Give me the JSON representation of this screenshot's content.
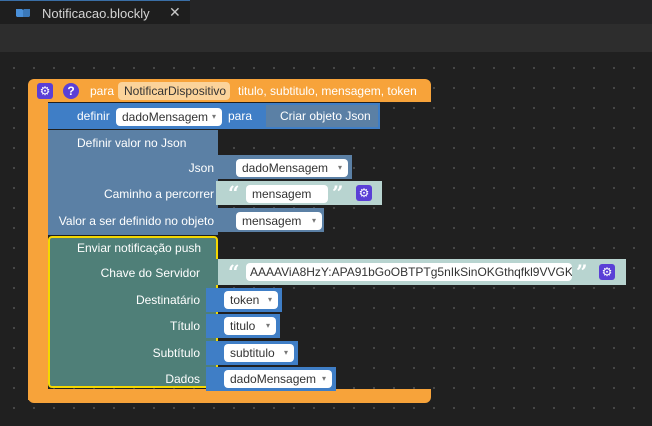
{
  "tab": {
    "title": "Notificacao.blockly",
    "close": "✕"
  },
  "procedure": {
    "para": "para",
    "name": "NotificarDispositivo",
    "params": "titulo, subtitulo, mensagem, token",
    "help": "?"
  },
  "definir": {
    "label": "definir",
    "variable": "dadoMensagem",
    "para": "para",
    "value": "Criar objeto Json"
  },
  "json_block": {
    "title": "Definir valor no Json",
    "json_label": "Json",
    "json_var": "dadoMensagem",
    "path_label": "Caminho a percorrer",
    "path_value": "mensagem",
    "value_label": "Valor a ser definido no objeto",
    "value_var": "mensagem"
  },
  "push_block": {
    "title": "Enviar notificação push",
    "server_key_label": "Chave do Servidor",
    "server_key_value": "AAAAViA8HzY:APA91bGoOBTPTg5nIkSinOKGthqfkl9VVGKI...",
    "dest_label": "Destinatário",
    "dest_var": "token",
    "title_label": "Título",
    "title_var": "titulo",
    "subtitle_label": "Subtítulo",
    "subtitle_var": "subtitulo",
    "data_label": "Dados",
    "data_var": "dadoMensagem"
  },
  "icons": {
    "gear": "⚙",
    "dropdown": "▾",
    "open_quote": "“",
    "close_quote": "”"
  },
  "colors": {
    "procedure": "#f7a33a",
    "json": "#5b80a5",
    "push": "#4f7f78",
    "text_value": "#b8d4d0",
    "mutator": "#5a3fd6"
  }
}
